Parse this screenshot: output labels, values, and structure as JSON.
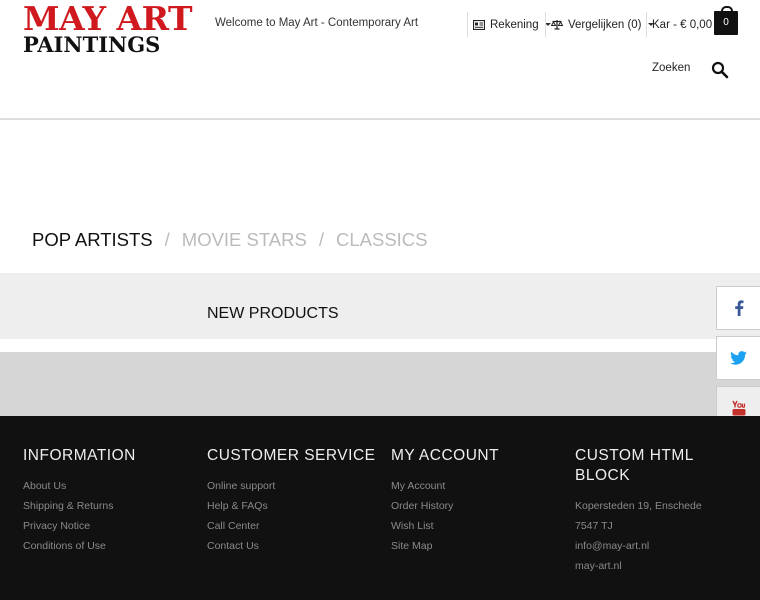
{
  "header": {
    "logo_line1": "MAY ART",
    "logo_line2": "PAINTINGS",
    "welcome": "Welcome to May Art - Contemporary Art",
    "account_label": "Rekening",
    "compare_label": "Vergelijken (0)",
    "cart_label": "Kar - € 0,00",
    "cart_count": "0",
    "search_label": "Zoeken",
    "icons": {
      "account": "account-card-icon",
      "compare": "scale-icon",
      "cart": "shopping-bag-icon",
      "search": "search-icon"
    },
    "brand_color": "#d0191e"
  },
  "tabs": [
    {
      "label": "POP ARTISTS",
      "active": true
    },
    {
      "label": "MOVIE STARS",
      "active": false
    },
    {
      "label": "CLASSICS",
      "active": false
    }
  ],
  "new_products": {
    "title": "NEW PRODUCTS"
  },
  "social": [
    {
      "icon": "facebook-icon",
      "color": "#3b5998"
    },
    {
      "icon": "twitter-icon",
      "color": "#1da1f2"
    },
    {
      "icon": "youtube-icon",
      "color": "#c4302b"
    }
  ],
  "footer": {
    "columns": [
      {
        "title": "INFORMATION",
        "items": [
          "About Us",
          "Shipping & Returns",
          "Privacy Notice",
          "Conditions of Use"
        ]
      },
      {
        "title": "CUSTOMER SERVICE",
        "items": [
          "Online support",
          "Help & FAQs",
          "Call Center",
          "Contact Us"
        ]
      },
      {
        "title": "MY ACCOUNT",
        "items": [
          "My Account",
          "Order History",
          "Wish List",
          "Site Map"
        ]
      },
      {
        "title": "CUSTOM HTML BLOCK",
        "items": [
          "Kopersteden 19, Enschede",
          "7547 TJ",
          "info@may-art.nl",
          "may-art.nl"
        ]
      }
    ]
  }
}
